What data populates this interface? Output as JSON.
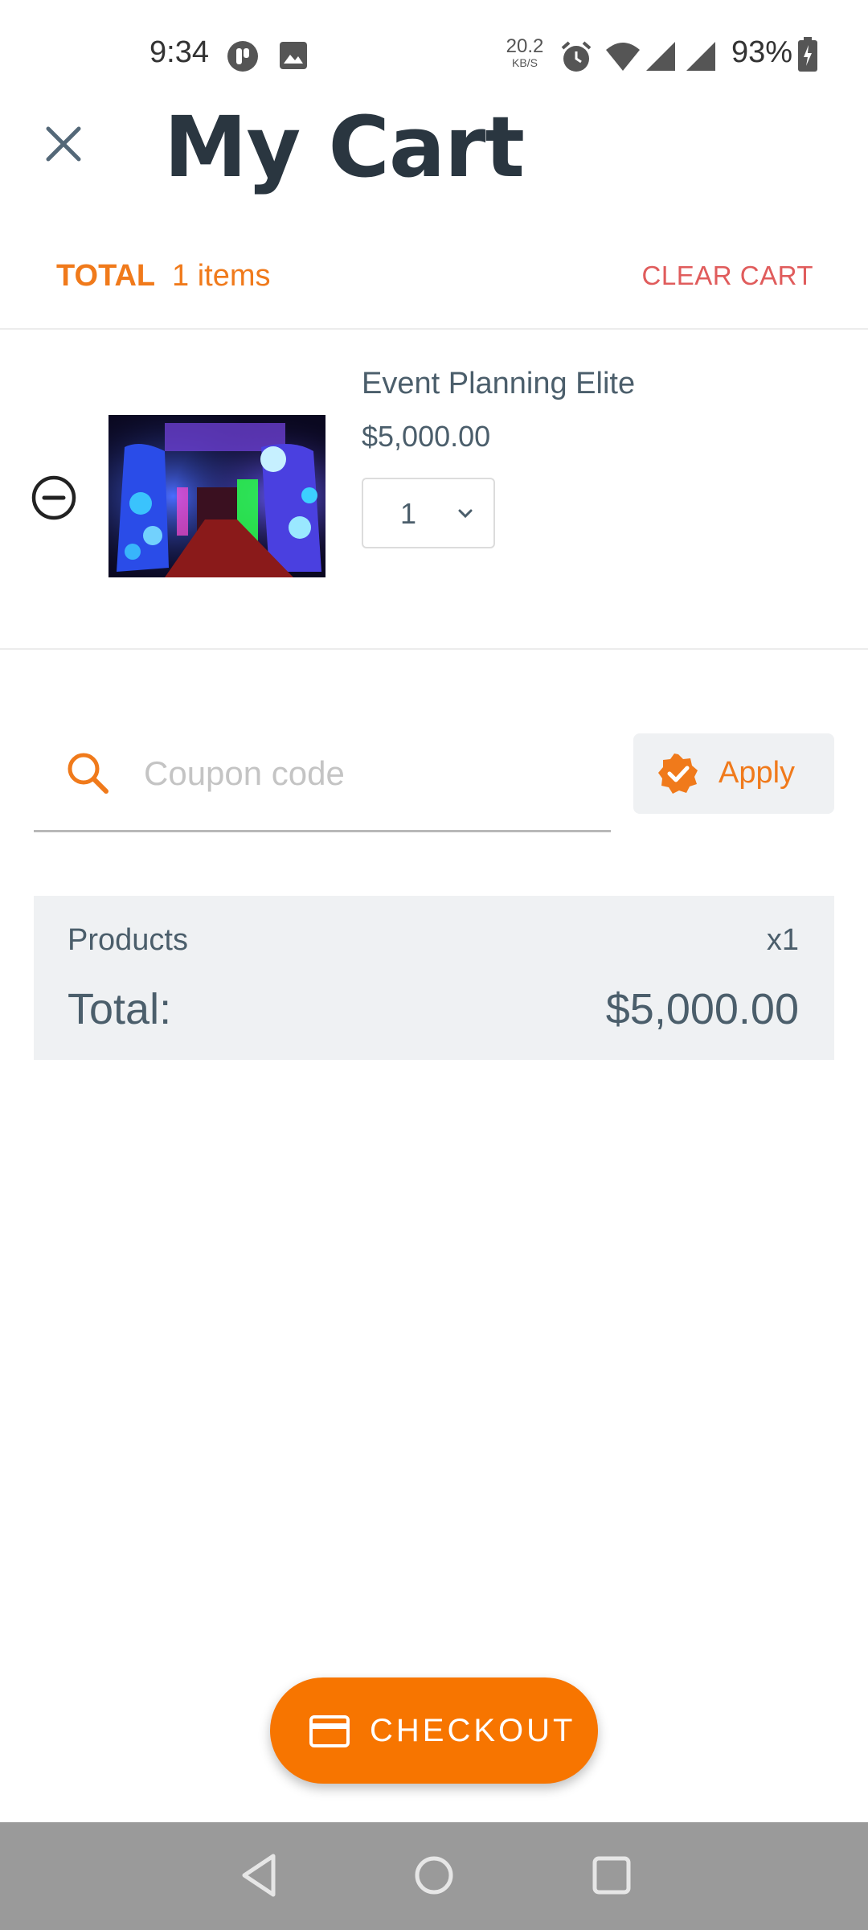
{
  "status_bar": {
    "time": "9:34",
    "net_speed_value": "20.2",
    "net_speed_unit": "KB/S",
    "battery": "93%"
  },
  "header": {
    "title": "My Cart",
    "close_icon": "close-icon"
  },
  "totals": {
    "label": "TOTAL",
    "items": "1 items",
    "clear_label": "CLEAR CART"
  },
  "cart": {
    "items": [
      {
        "name": "Event Planning Elite",
        "price": "$5,000.00",
        "quantity": "1"
      }
    ]
  },
  "coupon": {
    "placeholder": "Coupon code",
    "value": "",
    "apply_label": "Apply"
  },
  "summary": {
    "products_label": "Products",
    "products_count": "x1",
    "total_label": "Total:",
    "total_value": "$5,000.00"
  },
  "checkout": {
    "label": "CHECKOUT"
  },
  "colors": {
    "accent": "#f77500",
    "danger": "#e05c5c",
    "text": "#4b5e6b"
  }
}
